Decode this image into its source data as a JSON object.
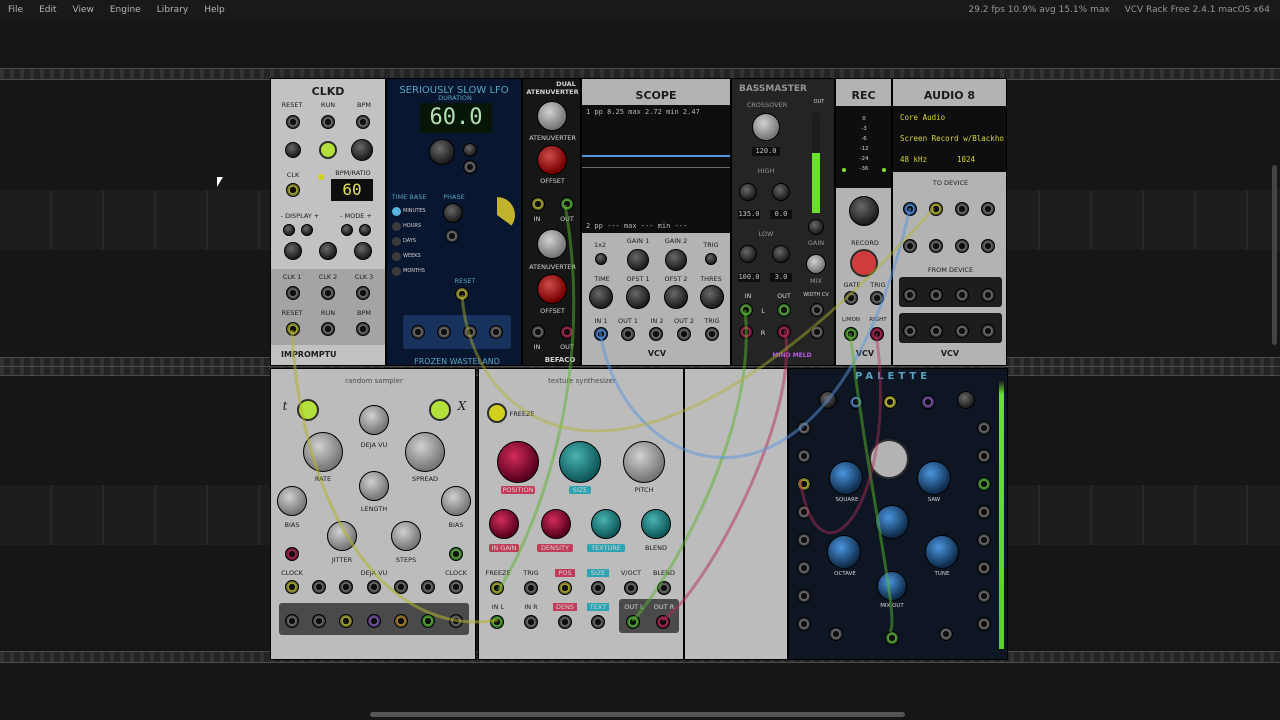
{
  "menu": {
    "file": "File",
    "edit": "Edit",
    "view": "View",
    "engine": "Engine",
    "library": "Library",
    "help": "Help"
  },
  "status": {
    "stats": "29.2 fps  10.9% avg  15.1% max",
    "app": "VCV Rack Free 2.4.1 macOS x64"
  },
  "clkd": {
    "title": "CLKD",
    "reset": "RESET",
    "run": "RUN",
    "bpm": "BPM",
    "clk": "CLK",
    "bpm_ratio": "BPM/RATIO",
    "bpm_value": "60",
    "display": "- DISPLAY +",
    "mode": "- MODE +",
    "clk1": "CLK 1",
    "clk2": "CLK 2",
    "clk3": "CLK 3",
    "reset2": "RESET",
    "run2": "RUN",
    "bpm2": "BPM",
    "brand": "IMPROMPTU"
  },
  "lfo": {
    "title": "SERIOUSLY SLOW LFO",
    "duration": "DURATION",
    "value": "60.0",
    "timebase": "TIME BASE",
    "phase": "PHASE",
    "minutes": "MINUTES",
    "hours": "HOURS",
    "days": "DAYS",
    "weeks": "WEEKS",
    "months": "MONTHS",
    "reset": "RESET",
    "brand": "FROZEN WASTELAND"
  },
  "atten": {
    "dual": "DUAL",
    "title": "ATENUVERTER",
    "atenuverter": "ATENUVERTER",
    "offset": "OFFSET",
    "in": "IN",
    "out": "OUT",
    "brand": "BEFACO"
  },
  "scope": {
    "title": "SCOPE",
    "line1": "1  pp   8.25 max   2.72 min   2.47",
    "line2": "2  pp   ---  max   ---  min   ---",
    "x2": "1x2",
    "gain1": "GAIN 1",
    "gain2": "GAIN 2",
    "trig": "TRIG",
    "time": "TIME",
    "ofst1": "OFST 1",
    "ofst2": "OFST 2",
    "thres": "THRES",
    "in1": "IN 1",
    "out1": "OUT 1",
    "in2": "IN 2",
    "out2": "OUT 2",
    "trig2": "TRIG",
    "brand": "VCV"
  },
  "bassmaster": {
    "title": "BASSMASTER",
    "out": "OUT",
    "crossover": "CROSSOVER",
    "freq": "120.0",
    "high": "HIGH",
    "width_high": "135.0",
    "gain_high": "0.0",
    "low": "LOW",
    "width_low": "100.0",
    "gain_low": "3.0",
    "gain": "GAIN",
    "mix": "MIX",
    "in": "IN",
    "out2": "OUT",
    "width_cv": "WIDTH CV",
    "l": "L",
    "r": "R",
    "brand": "MIND MELD"
  },
  "rec": {
    "title": "REC",
    "record": "RECORD",
    "gate": "GATE",
    "trig": "TRIG",
    "left": "L/MON",
    "right": "RIGHT",
    "brand": "VCV",
    "meter": [
      "0",
      "-3",
      "-6",
      "-12",
      "-24",
      "-36"
    ]
  },
  "audio": {
    "title": "AUDIO 8",
    "driver": "Core Audio",
    "device": "Screen Record w/Blackho",
    "rate": "48 kHz",
    "block": "1024",
    "to_device": "TO DEVICE",
    "from_device": "FROM DEVICE",
    "brand": "VCV"
  },
  "sampler": {
    "title": "random sampler",
    "t": "t",
    "x": "X",
    "deja": "DEJA VU",
    "rate": "RATE",
    "spread": "SPREAD",
    "length": "LENGTH",
    "bias": "BIAS",
    "bias2": "BIAS",
    "jitter": "JITTER",
    "steps": "STEPS",
    "clock": "CLOCK",
    "deja2": "DEJA VU",
    "clock2": "CLOCK"
  },
  "texture": {
    "title": "texture synthesizer",
    "freeze": "FREEZE",
    "position": "POSITION",
    "size": "SIZE",
    "pitch": "PITCH",
    "in_gain": "IN GAIN",
    "density": "DENSITY",
    "texture": "TEXTURE",
    "blend": "BLEND",
    "freeze2": "FREEZE",
    "trig": "TRIG",
    "pos": "POS",
    "size2": "SIZE",
    "voct": "V/OCT",
    "blend2": "BLEND",
    "in_l": "IN L",
    "in_r": "IN R",
    "dens": "DENS",
    "text": "TEXT",
    "out_l": "OUT L",
    "out_r": "OUT R"
  },
  "palette": {
    "title": "PALETTE",
    "square": "SQUARE",
    "saw": "SAW",
    "octave": "OCTAVE",
    "tune": "TUNE",
    "mix_out": "MIX OUT"
  }
}
